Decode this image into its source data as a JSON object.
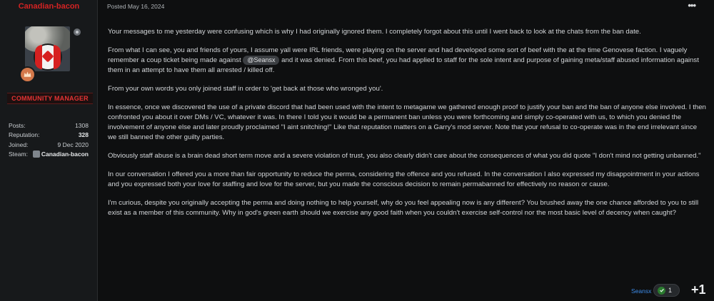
{
  "author": {
    "username": "Canadian-bacon",
    "role": "COMMUNITY MANAGER",
    "stats": [
      {
        "label": "Posts:",
        "value": "1308"
      },
      {
        "label": "Reputation:",
        "value": "328"
      },
      {
        "label": "Joined:",
        "value": "9 Dec 2020"
      }
    ],
    "steam": {
      "label": "Steam:",
      "value": "Canadian-bacon"
    }
  },
  "post": {
    "date": "Posted May 16, 2024",
    "p1": "Your messages to me yesterday were confusing which is why I had originally ignored them. I completely forgot about this until I went back to look at the chats from the ban date.",
    "p2_before": "From what I can see, you and friends of yours, I assume yall were IRL friends, were playing on the server and had developed some sort of beef with the at the time Genovese faction. I vaguely remember a coup ticket being made against ",
    "p2_mention": "@Seansx",
    "p2_after": " and it was denied. From this beef, you had applied to staff for the sole intent and purpose of gaining meta/staff abused information against them in an attempt to have them all arrested / killed off.",
    "p3": "From your own words you only joined staff in order to 'get back at those who wronged you'.",
    "p4": "In essence, once we discovered the use of a private discord that had been used with the intent to metagame we gathered enough proof to justify your ban and the ban of anyone else involved. I then confronted you about it over DMs / VC, whatever it was. In there I told you it would be a permanent ban unless you were forthcoming and simply co-operated with us, to which you denied the involvement of anyone else and later proudly proclaimed \"I aint snitching!\" Like that reputation matters on a Garry's mod server. Note that your refusal to co-operate was in the end irrelevant since we still banned the other guilty parties.",
    "p5": "Obviously staff abuse is a brain dead short term move and a severe violation of trust, you also clearly didn't care about the consequences of what you did quote \"I don't mind not getting unbanned.\"",
    "p6": "In our conversation I offered you a more than fair opportunity to reduce the perma, considering the offence and you refused. In the conversation I also expressed my disappointment in your actions and you expressed both your love for staffing and love for the server, but you made the conscious decision to remain permabanned for effectively no reason or cause.",
    "p7": "I'm curious, despite you originally accepting the perma and doing nothing to help yourself, why do you feel appealing now is any different? You brushed away the one chance afforded to you to still exist as a member of this community. Why in god's green earth should we exercise any good faith when you couldn't exercise self-control nor the most basic level of decency when caught?"
  },
  "reactions": {
    "reactor": "Seansx",
    "count": "1",
    "plus_label": "+1"
  },
  "colors": {
    "username": "#d42323",
    "role": "#e43333",
    "link": "#3d8be8",
    "check": "#2a7a2e"
  },
  "icons": {
    "more": "more-options-icon",
    "check": "check-icon",
    "rank": "rank-badge-icon",
    "steam": "steam-icon"
  }
}
